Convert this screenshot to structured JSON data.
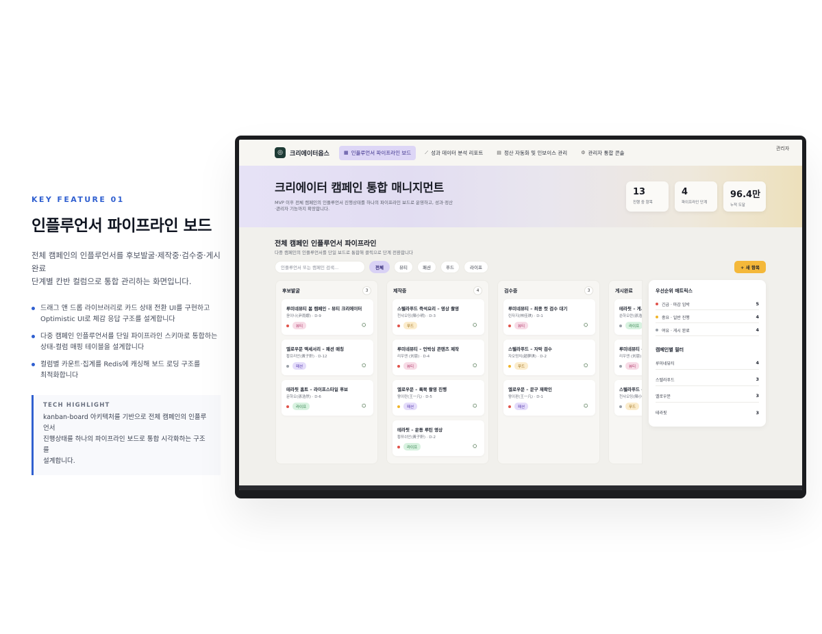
{
  "left": {
    "eyebrow": "KEY FEATURE 01",
    "title": "인플루언서 파이프라인 보드",
    "desc_line1": "전체 캠페인의 인플루언서를 후보발굴·제작중·검수중·게시완료",
    "desc_line2": "단계별 칸반 컬럼으로 통합 관리하는 화면입니다.",
    "bullets": [
      {
        "line1": "드래그 앤 드롭 라이브러리로 카드 상태 전환 UI를 구현하고",
        "line2": "Optimistic UI로 체감 응답 구조를 설계합니다"
      },
      {
        "line1": "다중 캠페인 인플루언서를 단일 파이프라인 스키마로 통합하는",
        "line2": "상태-컬럼 매핑 테이블을 설계합니다"
      },
      {
        "line1": "컬럼별 카운트·집계를 Redis에 캐싱해 보드 로딩 구조를",
        "line2": "최적화합니다"
      }
    ],
    "tech": {
      "label": "TECH HIGHLIGHT",
      "line1": "kanban-board 아키텍처를 기반으로 전체 캠페인의 인플루언서",
      "line2": "진행상태를 하나의 파이프라인 보드로 통합 시각화하는 구조를",
      "line3": "설계합니다."
    }
  },
  "app": {
    "brand": "크리에이터옵스",
    "nav": [
      {
        "label": "인플루언서 파이프라인 보드",
        "icon": "grid-icon",
        "glyph": "▦",
        "active": true
      },
      {
        "label": "성과 데이터 분석 리포트",
        "icon": "chart-icon",
        "glyph": "⟋",
        "active": false
      },
      {
        "label": "정산 자동화 및 인보이스 관리",
        "icon": "invoice-icon",
        "glyph": "▤",
        "active": false
      },
      {
        "label": "관리자 통합 콘솔",
        "icon": "gear-icon",
        "glyph": "⚙",
        "active": false
      }
    ],
    "user_alt": "관리자",
    "hero": {
      "title": "크리에이터 캠페인 통합 매니지먼트",
      "desc_line1": "MVP 이후 전체 캠페인의 인플루언서 진행상태를 하나의 파이프라인 보드로 운영하고, 성과·정산",
      "desc_line2": "·관리자 기능까지 확장합니다.",
      "stats": [
        {
          "value": "13",
          "label": "진행 중 항목"
        },
        {
          "value": "4",
          "label": "파이프라인 단계"
        },
        {
          "value": "96.4만",
          "label": "누적 도달"
        }
      ]
    },
    "board": {
      "title": "전체 캠페인 인플루언서 파이프라인",
      "subtitle": "다중 캠페인의 인플루언서를 단일 보드로 통합해 클릭으로 단계 전환합니다",
      "search_placeholder": "인플루언서 또는 캠페인 검색...",
      "filters": [
        "전체",
        "뷰티",
        "패션",
        "푸드",
        "라이프"
      ],
      "active_filter": "전체",
      "add_label": "+ 새 항목"
    },
    "columns": [
      {
        "name": "후보발굴",
        "count": "3",
        "cards": [
          {
            "title": "루미네뷰티 봄 캠페인 – 뷰티 크리에이터",
            "meta": "윤이나(尹雨娜) · D-9",
            "tag": "뷰티",
            "tag_type": "beauty",
            "dot": "#e0524a"
          },
          {
            "title": "엘로우문 액세서리 – 패션 매칭",
            "meta": "황프리안(黃子軒) · D-12",
            "tag": "패션",
            "tag_type": "fashion",
            "dot": "#9aa0a8"
          },
          {
            "title": "테라핏 홈트 – 라이프스타일 후보",
            "meta": "문하오(孫浩然) · D-6",
            "tag": "라이프",
            "tag_type": "life",
            "dot": "#e0524a"
          }
        ]
      },
      {
        "name": "제작중",
        "count": "4",
        "cards": [
          {
            "title": "스텔라푸드 즉석요리 – 영상 촬영",
            "meta": "천샤오밍(陳小明) · D-3",
            "tag": "푸드",
            "tag_type": "food",
            "dot": "#e0524a"
          },
          {
            "title": "루미네뷰티 – 언박싱 콘텐츠 제작",
            "meta": "리우엔 (刘恩) · D-4",
            "tag": "뷰티",
            "tag_type": "beauty",
            "dot": "#e0524a"
          },
          {
            "title": "엘로우문 – 룩북 촬영 진행",
            "meta": "왕이란(王一凡) · D-5",
            "tag": "패션",
            "tag_type": "fashion",
            "dot": "#f0b429"
          },
          {
            "title": "테라핏 – 운동 루틴 영상",
            "meta": "황쯔쉬안(黃子軒) · D-2",
            "tag": "라이프",
            "tag_type": "life",
            "dot": "#e0524a"
          }
        ]
      },
      {
        "name": "검수중",
        "count": "3",
        "cards": [
          {
            "title": "루미네뷰티 – 최종 컷 검수 대기",
            "meta": "린자지(林佳琪) · D-1",
            "tag": "뷰티",
            "tag_type": "beauty",
            "dot": "#e0524a"
          },
          {
            "title": "스텔라푸드 – 자막 검수",
            "meta": "자오멍치(趙夢琪) · D-2",
            "tag": "푸드",
            "tag_type": "food",
            "dot": "#f0b429"
          },
          {
            "title": "엘로우문 – 문구 재확인",
            "meta": "왕이판(王一凡) · D-1",
            "tag": "패션",
            "tag_type": "fashion",
            "dot": "#e0524a"
          }
        ]
      },
      {
        "name": "게시완료",
        "count": "",
        "cards": [
          {
            "title": "테라핏 – 게시 완료",
            "meta": "쑨하오란(孫浩然)",
            "tag": "라이프",
            "tag_type": "life",
            "dot": "#9aa0a8"
          },
          {
            "title": "루미네뷰티 – 게시",
            "meta": "리우엔 (刘恩)",
            "tag": "뷰티",
            "tag_type": "beauty",
            "dot": "#9aa0a8"
          },
          {
            "title": "스텔라푸드 – 게시",
            "meta": "천샤오밍(陳小明)",
            "tag": "푸드",
            "tag_type": "food",
            "dot": "#9aa0a8"
          }
        ]
      }
    ],
    "panel": {
      "priority_title": "우선순위 매트릭스",
      "priority": [
        {
          "label": "긴급 · 마감 임박",
          "value": "5",
          "color": "#e0524a"
        },
        {
          "label": "중요 · 일반 진행",
          "value": "4",
          "color": "#f0b429"
        },
        {
          "label": "여유 · 게시 완료",
          "value": "4",
          "color": "#9aa0a8"
        }
      ],
      "filter_title": "캠페인별 필터",
      "campaigns": [
        {
          "label": "루미네뷰티",
          "value": "4"
        },
        {
          "label": "스텔라푸드",
          "value": "3"
        },
        {
          "label": "옐로우문",
          "value": "3"
        },
        {
          "label": "테라핏",
          "value": "3"
        }
      ]
    }
  }
}
